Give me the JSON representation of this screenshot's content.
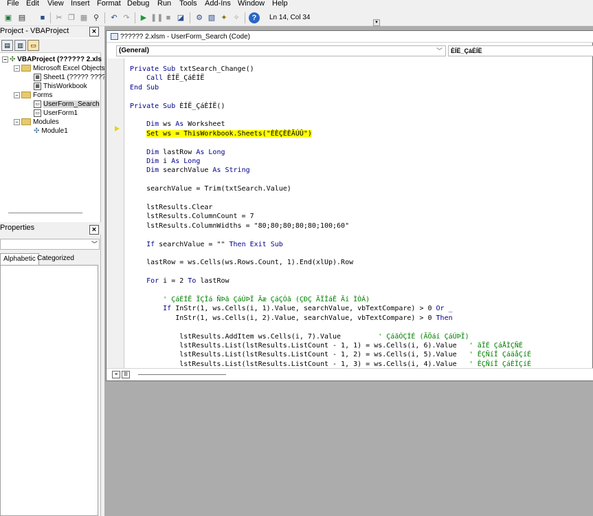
{
  "menubar": {
    "items": [
      "File",
      "Edit",
      "View",
      "Insert",
      "Format",
      "Debug",
      "Run",
      "Tools",
      "Add-Ins",
      "Window",
      "Help"
    ]
  },
  "toolbar": {
    "status_position": "Ln 14, Col 34"
  },
  "project_panel": {
    "title": "Project - VBAProject",
    "close": "×",
    "tree": {
      "root": "VBAProject (?????? 2.xls",
      "excel_objects_folder": "Microsoft Excel Objects",
      "sheet1": "Sheet1 (????? ?????",
      "thisworkbook": "ThisWorkbook",
      "forms_folder": "Forms",
      "userform_search": "UserForm_Search",
      "userform1": "UserForm1",
      "modules_folder": "Modules",
      "module1": "Module1"
    }
  },
  "properties_panel": {
    "title": "Properties",
    "close": "×",
    "tab_alphabetic": "Alphabetic",
    "tab_categorized": "Categorized"
  },
  "code_window": {
    "title": "?????? 2.xlsm - UserForm_Search (Code)",
    "object_combo": "(General)",
    "procedure_combo": "ÈÍË_ÇáÈÍË",
    "lines": [
      [
        {
          "t": "Private Sub ",
          "c": "kw"
        },
        {
          "t": "txtSearch_Change()",
          "c": ""
        }
      ],
      [
        {
          "t": "    Call ",
          "c": "kw"
        },
        {
          "t": "ÈÍË_ÇáÈÍË",
          "c": ""
        }
      ],
      [
        {
          "t": "End Sub",
          "c": "kw"
        }
      ],
      [],
      [
        {
          "t": "Private Sub ",
          "c": "kw"
        },
        {
          "t": "ÈÍË_ÇáÈÍË()",
          "c": ""
        }
      ],
      [],
      [
        {
          "t": "    Dim ",
          "c": "kw"
        },
        {
          "t": "ws ",
          "c": ""
        },
        {
          "t": "As ",
          "c": "kw"
        },
        {
          "t": "Worksheet",
          "c": ""
        }
      ],
      [
        {
          "t": "    ",
          "c": ""
        },
        {
          "t": "Set ws = ThisWorkbook.Sheets(\"ÈÈÇÈÈÃÚÛ\")",
          "c": "hl"
        }
      ],
      [],
      [
        {
          "t": "    Dim ",
          "c": "kw"
        },
        {
          "t": "lastRow ",
          "c": ""
        },
        {
          "t": "As Long",
          "c": "kw"
        }
      ],
      [
        {
          "t": "    Dim ",
          "c": "kw"
        },
        {
          "t": "i ",
          "c": ""
        },
        {
          "t": "As Long",
          "c": "kw"
        }
      ],
      [
        {
          "t": "    Dim ",
          "c": "kw"
        },
        {
          "t": "searchValue ",
          "c": ""
        },
        {
          "t": "As String",
          "c": "kw"
        }
      ],
      [],
      [
        {
          "t": "    searchValue = Trim(txtSearch.Value)",
          "c": ""
        }
      ],
      [],
      [
        {
          "t": "    lstResults.Clear",
          "c": ""
        }
      ],
      [
        {
          "t": "    lstResults.ColumnCount = 7",
          "c": ""
        }
      ],
      [
        {
          "t": "    lstResults.ColumnWidths = \"80;80;80;80;80;100;60\"",
          "c": ""
        }
      ],
      [],
      [
        {
          "t": "    If ",
          "c": "kw"
        },
        {
          "t": "searchValue = \"\" ",
          "c": ""
        },
        {
          "t": "Then Exit Sub",
          "c": "kw"
        }
      ],
      [],
      [
        {
          "t": "    lastRow = ws.Cells(ws.Rows.Count, 1).End(xlUp).Row",
          "c": ""
        }
      ],
      [],
      [
        {
          "t": "    For ",
          "c": "kw"
        },
        {
          "t": "i = 2 ",
          "c": ""
        },
        {
          "t": "To ",
          "c": "kw"
        },
        {
          "t": "lastRow",
          "c": ""
        }
      ],
      [],
      [
        {
          "t": "        ' ÇáÈÍË ÏÇÎá ÑÞã ÇáÚÞÏ Ãæ ÇáÇÓã (ÇÐÇ ÃÏÎáÊ Ãí ÌÒÁ)",
          "c": "cm"
        }
      ],
      [
        {
          "t": "        If ",
          "c": "kw"
        },
        {
          "t": "InStr(1, ws.Cells(i, 1).Value, searchValue, vbTextCompare) > 0 ",
          "c": ""
        },
        {
          "t": "Or _",
          "c": "kw"
        }
      ],
      [
        {
          "t": "           InStr(1, ws.Cells(i, 2).Value, searchValue, vbTextCompare) > 0 ",
          "c": ""
        },
        {
          "t": "Then",
          "c": "kw"
        }
      ],
      [],
      [
        {
          "t": "            lstResults.AddItem ws.Cells(i, 7).Value         ",
          "c": ""
        },
        {
          "t": "' ÇáãÓÇÍÉ (ÃÖáí ÇáÚÞÏ)",
          "c": "cm"
        }
      ],
      [
        {
          "t": "            lstResults.List(lstResults.ListCount - 1, 1) = ws.Cells(i, 6).Value   ",
          "c": ""
        },
        {
          "t": "' ãÏÉ ÇáÅÌÇÑÉ",
          "c": "cm"
        }
      ],
      [
        {
          "t": "            lstResults.List(lstResults.ListCount - 1, 2) = ws.Cells(i, 5).Value   ",
          "c": ""
        },
        {
          "t": "' ÊÇÑíÎ ÇáäåÇíÉ",
          "c": "cm"
        }
      ],
      [
        {
          "t": "            lstResults.List(lstResults.ListCount - 1, 3) = ws.Cells(i, 4).Value   ",
          "c": ""
        },
        {
          "t": "' ÊÇÑíÎ ÇáÈÏÇíÉ",
          "c": "cm"
        }
      ]
    ]
  }
}
